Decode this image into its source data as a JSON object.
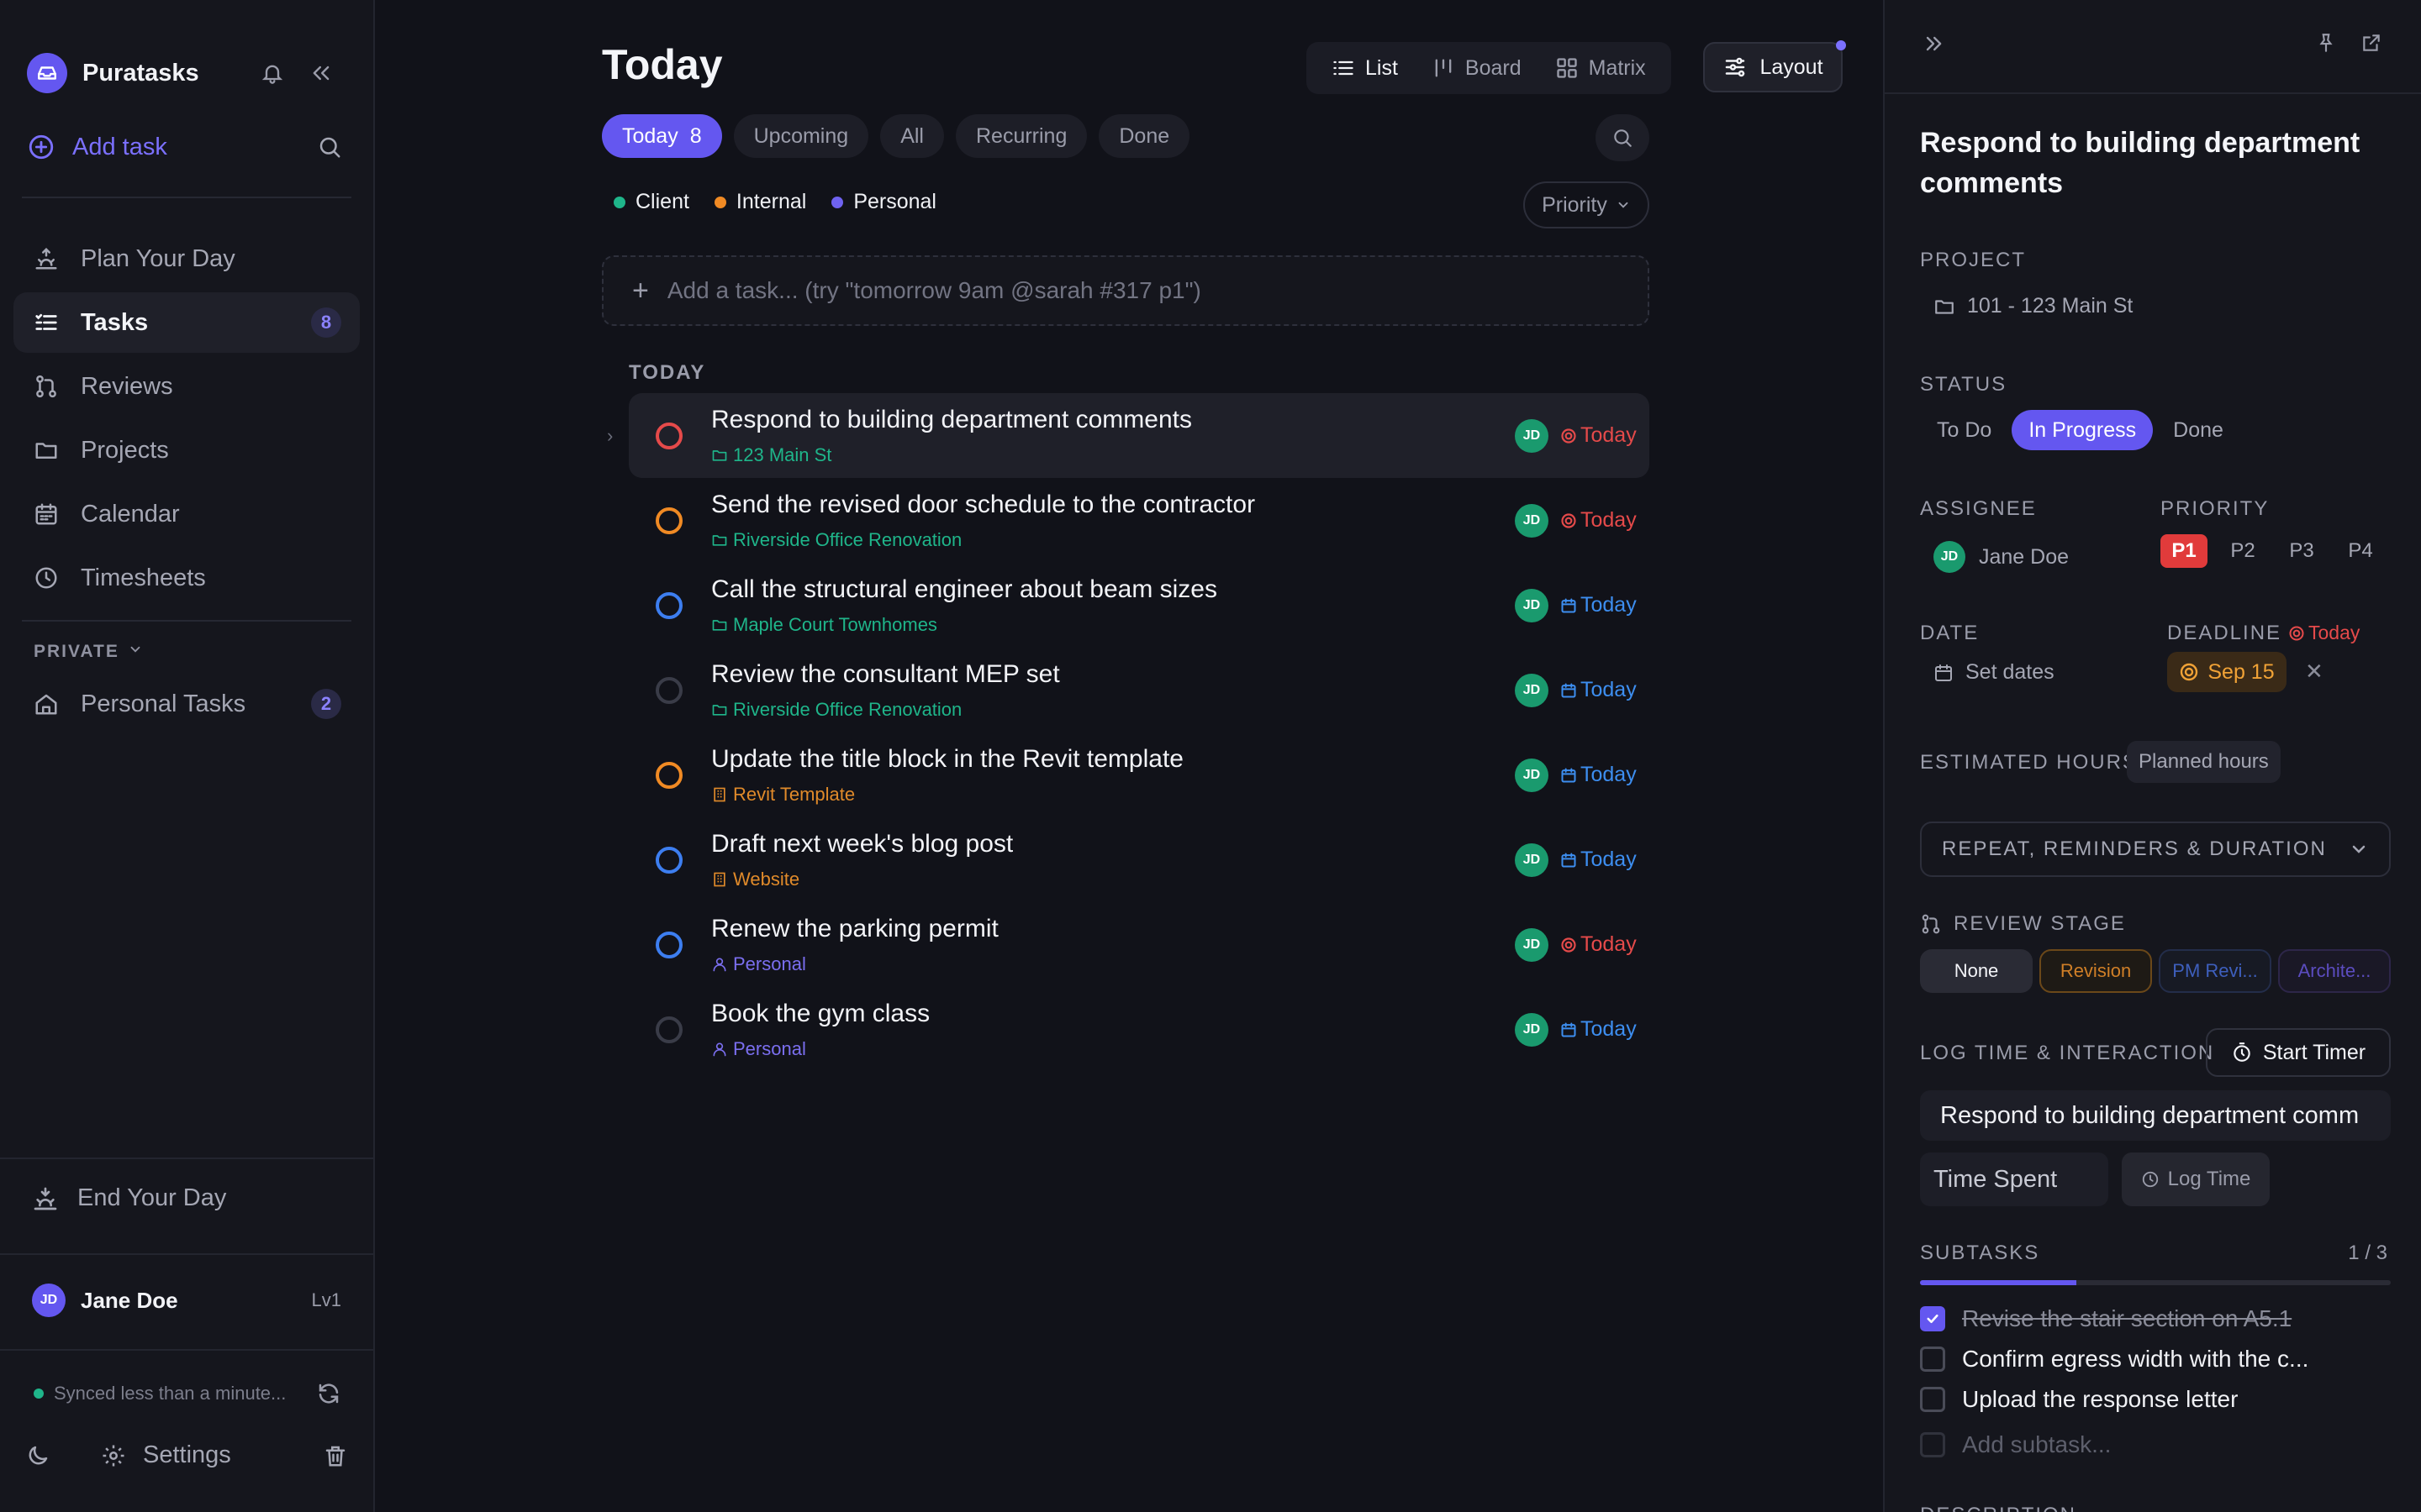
{
  "sidebar": {
    "brand": "Puratasks",
    "add_task": "Add task",
    "nav": [
      {
        "label": "Plan Your Day",
        "icon": "sunrise-icon"
      },
      {
        "label": "Tasks",
        "icon": "tasks-icon",
        "count": "8"
      },
      {
        "label": "Reviews",
        "icon": "git-pull-icon"
      },
      {
        "label": "Projects",
        "icon": "folder-icon"
      },
      {
        "label": "Calendar",
        "icon": "calendar-icon"
      },
      {
        "label": "Timesheets",
        "icon": "clock-icon"
      }
    ],
    "private_label": "PRIVATE",
    "personal_tasks": {
      "label": "Personal Tasks",
      "count": "2"
    },
    "end_day": "End Your Day",
    "user": {
      "initials": "JD",
      "name": "Jane Doe",
      "level": "Lv1"
    },
    "sync_text": "Synced less than a minute...",
    "settings": "Settings"
  },
  "main": {
    "title": "Today",
    "views": [
      {
        "label": "List",
        "icon": "list-icon"
      },
      {
        "label": "Board",
        "icon": "board-icon"
      },
      {
        "label": "Matrix",
        "icon": "matrix-icon"
      }
    ],
    "layout_label": "Layout",
    "filters": [
      {
        "label": "Today",
        "count": "8"
      },
      {
        "label": "Upcoming"
      },
      {
        "label": "All"
      },
      {
        "label": "Recurring"
      },
      {
        "label": "Done"
      }
    ],
    "legend": [
      {
        "label": "Client",
        "color": "#1fb58a"
      },
      {
        "label": "Internal",
        "color": "#f08a24"
      },
      {
        "label": "Personal",
        "color": "#6f62f0"
      }
    ],
    "sort_label": "Priority",
    "quick_add_placeholder": "Add a task... (try \"tomorrow 9am @sarah #317 p1\")",
    "section_label": "TODAY",
    "tasks": [
      {
        "title": "Respond to building department comments",
        "project": "123 Main St",
        "project_icon": "folder-icon",
        "project_color": "#1fb58a",
        "circle_color": "#e54a4a",
        "assignee": "JD",
        "due": "Today",
        "due_icon": "target-icon",
        "due_color": "#e54a4a"
      },
      {
        "title": "Send the revised door schedule to the contractor",
        "project": "Riverside Office Renovation",
        "project_icon": "folder-icon",
        "project_color": "#1fb58a",
        "circle_color": "#f08a24",
        "assignee": "JD",
        "due": "Today",
        "due_icon": "target-icon",
        "due_color": "#e54a4a"
      },
      {
        "title": "Call the structural engineer about beam sizes",
        "project": "Maple Court Townhomes",
        "project_icon": "folder-icon",
        "project_color": "#1fb58a",
        "circle_color": "#3d7ef0",
        "assignee": "JD",
        "due": "Today",
        "due_icon": "calendar-icon",
        "due_color": "#3d8ef0"
      },
      {
        "title": "Review the consultant MEP set",
        "project": "Riverside Office Renovation",
        "project_icon": "folder-icon",
        "project_color": "#1fb58a",
        "circle_color": "#3a3c48",
        "assignee": "JD",
        "due": "Today",
        "due_icon": "calendar-icon",
        "due_color": "#3d8ef0"
      },
      {
        "title": "Update the title block in the Revit template",
        "project": "Revit Template",
        "project_icon": "building-icon",
        "project_color": "#e08a2a",
        "circle_color": "#f08a24",
        "assignee": "JD",
        "due": "Today",
        "due_icon": "calendar-icon",
        "due_color": "#3d8ef0"
      },
      {
        "title": "Draft next week's blog post",
        "project": "Website",
        "project_icon": "building-icon",
        "project_color": "#e08a2a",
        "circle_color": "#3d7ef0",
        "assignee": "JD",
        "due": "Today",
        "due_icon": "calendar-icon",
        "due_color": "#3d8ef0"
      },
      {
        "title": "Renew the parking permit",
        "project": "Personal",
        "project_icon": "person-icon",
        "project_color": "#7b6ff0",
        "circle_color": "#3d7ef0",
        "assignee": "JD",
        "due": "Today",
        "due_icon": "target-icon",
        "due_color": "#e54a4a"
      },
      {
        "title": "Book the gym class",
        "project": "Personal",
        "project_icon": "person-icon",
        "project_color": "#7b6ff0",
        "circle_color": "#3a3c48",
        "assignee": "JD",
        "due": "Today",
        "due_icon": "calendar-icon",
        "due_color": "#3d8ef0"
      }
    ]
  },
  "panel": {
    "title": "Respond to building department comments",
    "project_label": "PROJECT",
    "project_value": "101 - 123 Main St",
    "status_label": "STATUS",
    "status_options": [
      "To Do",
      "In Progress",
      "Done"
    ],
    "status_active": "In Progress",
    "assignee_label": "ASSIGNEE",
    "assignee": {
      "initials": "JD",
      "name": "Jane Doe"
    },
    "priority_label": "PRIORITY",
    "priority_options": [
      "P1",
      "P2",
      "P3",
      "P4"
    ],
    "date_label": "DATE",
    "date_value": "Set dates",
    "deadline_label": "DEADLINE",
    "deadline_today": "Today",
    "deadline_value": "Sep 15",
    "est_label": "ESTIMATED HOURS",
    "est_placeholder": "Planned hours",
    "repeat_label": "REPEAT, REMINDERS & DURATION",
    "review_label": "REVIEW STAGE",
    "review_options": [
      "None",
      "Revision",
      "PM Revi...",
      "Archite..."
    ],
    "log_label": "LOG TIME & INTERACTION",
    "start_timer": "Start Timer",
    "log_input_value": "Respond to building department comm",
    "time_spent_placeholder": "Time Spent",
    "log_time_button": "Log Time",
    "subtasks_label": "SUBTASKS",
    "subtasks_count": "1 / 3",
    "subtasks_progress": 0.333,
    "subtasks": [
      {
        "label": "Revise the stair section on A5.1",
        "done": true
      },
      {
        "label": "Confirm egress width with the c...",
        "done": false
      },
      {
        "label": "Upload the response letter",
        "done": false
      }
    ],
    "add_subtask": "Add subtask...",
    "description_label": "DESCRIPTION"
  }
}
